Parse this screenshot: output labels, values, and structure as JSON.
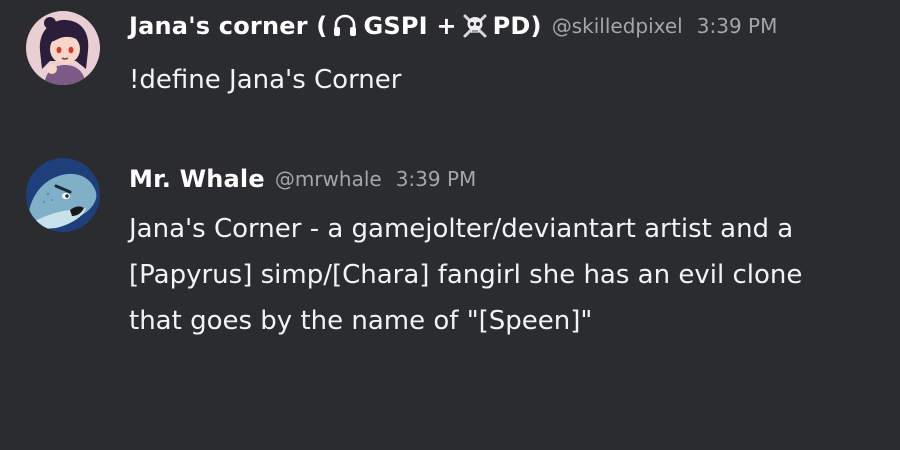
{
  "messages": [
    {
      "avatar_icon": "cartoon-girl-avatar",
      "username": {
        "part1": "Jana's corner (",
        "icon1": "headphones-icon",
        "part2": " GSPI + ",
        "icon2": "skull-crossbones-icon",
        "part3": " PD)"
      },
      "handle": "@skilledpixel",
      "time": "3:39 PM",
      "text": "!define Jana's Corner"
    },
    {
      "avatar_icon": "whale-avatar",
      "username": {
        "full": "Mr. Whale"
      },
      "handle": "@mrwhale",
      "time": "3:39 PM",
      "text": "Jana's Corner - a gamejolter/deviantart artist and a [Papyrus] simp/[Chara] fangirl she has an evil clone that goes by the name of \"[Speen]\""
    }
  ],
  "colors": {
    "background": "#2b2c2f",
    "username": "#ffffff",
    "meta": "#a3a6aa",
    "text": "#f2f3f5"
  }
}
